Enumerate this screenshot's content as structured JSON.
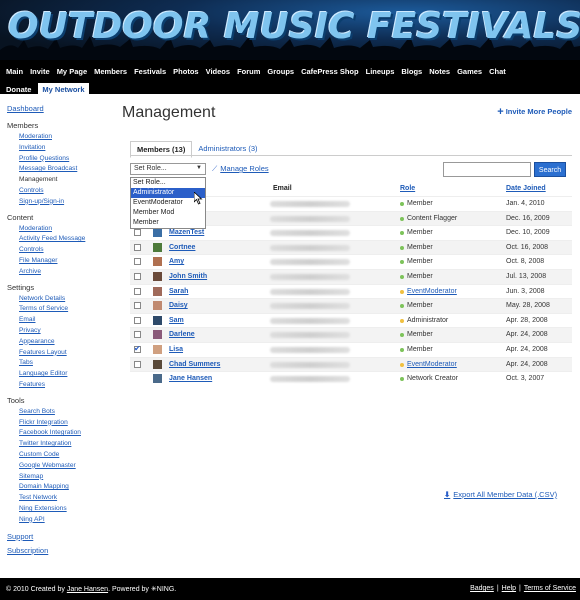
{
  "banner": {
    "title": "OUTDOOR MUSIC FESTIVALS"
  },
  "topnav": {
    "row1": [
      "Main",
      "Invite",
      "My Page",
      "Members",
      "Festivals",
      "Photos",
      "Videos",
      "Forum",
      "Groups",
      "CafePress Shop",
      "Lineups",
      "Blogs",
      "Notes",
      "Games",
      "Chat"
    ],
    "row2": [
      "Donate",
      "My Network"
    ],
    "active": "My Network"
  },
  "sidebar": {
    "dashboard": "Dashboard",
    "sections": [
      {
        "title": "Members",
        "items": [
          "Moderation",
          "Invitation",
          "Profile Questions",
          "Message Broadcast",
          "Management",
          "Controls",
          "Sign-up/Sign-in"
        ],
        "current": "Management"
      },
      {
        "title": "Content",
        "items": [
          "Moderation",
          "Activity Feed Message",
          "Controls",
          "File Manager",
          "Archive"
        ]
      },
      {
        "title": "Settings",
        "items": [
          "Network Details",
          "Terms of Service",
          "Email",
          "Privacy",
          "Appearance",
          "Features Layout",
          "Tabs",
          "Language Editor",
          "Features"
        ]
      },
      {
        "title": "Tools",
        "items": [
          "Search Bots",
          "Flickr Integration",
          "Facebook Integration",
          "Twitter Integration",
          "Custom Code",
          "Google Webmaster",
          "Sitemap",
          "Domain Mapping",
          "Test Network",
          "Ning Extensions",
          "Ning API"
        ]
      }
    ],
    "support": "Support",
    "subscription": "Subscription"
  },
  "main": {
    "title": "Management",
    "invite": "Invite More People",
    "tabs": [
      "Members (13)",
      "Administrators (3)"
    ],
    "role_select": "Set Role...",
    "role_options": [
      "Set Role...",
      "Administrator",
      "EventModerator",
      "Member Mod",
      "Member"
    ],
    "selected_option": "Administrator",
    "manage_roles": "Manage Roles",
    "search_button": "Search",
    "columns": {
      "email": "Email",
      "role": "Role",
      "date": "Date Joined"
    },
    "rows": [
      {
        "name": "",
        "role": "Member",
        "role_link": false,
        "date": "Jan. 4, 2010",
        "dot": "#7dc35a",
        "checked": false
      },
      {
        "name": "",
        "role": "Content Flagger",
        "role_link": false,
        "date": "Dec. 16, 2009",
        "dot": "#7dc35a",
        "checked": false
      },
      {
        "name": "MazenTest",
        "role": "Member",
        "role_link": false,
        "date": "Dec. 10, 2009",
        "dot": "#7dc35a",
        "checked": false
      },
      {
        "name": "Cortnee",
        "role": "Member",
        "role_link": false,
        "date": "Oct. 16, 2008",
        "dot": "#7dc35a",
        "checked": false
      },
      {
        "name": "Amy",
        "role": "Member",
        "role_link": false,
        "date": "Oct. 8, 2008",
        "dot": "#7dc35a",
        "checked": false
      },
      {
        "name": "John Smith",
        "role": "Member",
        "role_link": false,
        "date": "Jul. 13, 2008",
        "dot": "#7dc35a",
        "checked": false
      },
      {
        "name": "Sarah",
        "role": "EventModerator",
        "role_link": true,
        "date": "Jun. 3, 2008",
        "dot": "#f0c040",
        "checked": false
      },
      {
        "name": "Daisy",
        "role": "Member",
        "role_link": false,
        "date": "May. 28, 2008",
        "dot": "#7dc35a",
        "checked": false
      },
      {
        "name": "Sam",
        "role": "Administrator",
        "role_link": false,
        "date": "Apr. 28, 2008",
        "dot": "#f0c040",
        "checked": false
      },
      {
        "name": "Darlene",
        "role": "Member",
        "role_link": false,
        "date": "Apr. 24, 2008",
        "dot": "#7dc35a",
        "checked": false
      },
      {
        "name": "Lisa",
        "role": "Member",
        "role_link": false,
        "date": "Apr. 24, 2008",
        "dot": "#7dc35a",
        "checked": true
      },
      {
        "name": "Chad Summers",
        "role": "EventModerator",
        "role_link": true,
        "date": "Apr. 24, 2008",
        "dot": "#f0c040",
        "checked": false
      },
      {
        "name": "Jane Hansen",
        "role": "Network Creator",
        "role_link": false,
        "date": "Oct. 3, 2007",
        "dot": "#7dc35a",
        "checked": null
      }
    ],
    "export": "Export All Member Data (.CSV)"
  },
  "footer": {
    "copyright": "© 2010  Created by ",
    "creator": "Jane Hansen",
    "powered": ".   Powered by ",
    "ning": "NING.",
    "links": [
      "Badges",
      "Help",
      "Terms of Service"
    ]
  }
}
